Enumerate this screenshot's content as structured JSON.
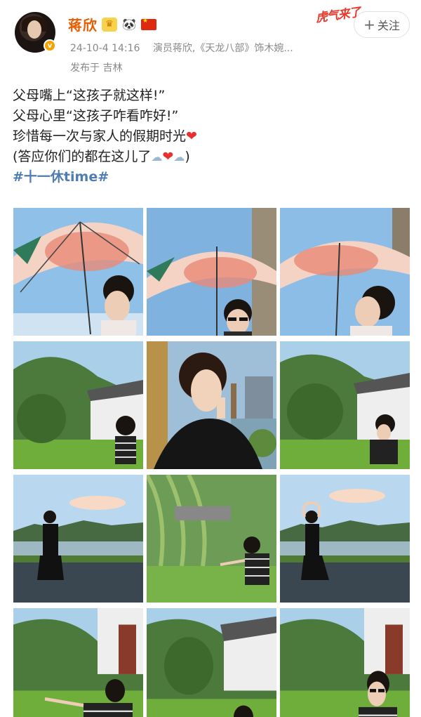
{
  "user": {
    "name": "蒋欣",
    "avatar_badge": "v",
    "badges": [
      "crown-icon",
      "panda-icon",
      "china-flag-icon"
    ]
  },
  "post_meta": {
    "date": "24-10-4 14:16",
    "source": "演员蒋欣,《天龙八部》饰木婉...",
    "location": "发布于 吉林"
  },
  "sticker": {
    "text": "虎气来了"
  },
  "follow_button": {
    "plus": "+",
    "label": "关注"
  },
  "content": {
    "line1": "父母嘴上“这孩子就这样!”",
    "line2": "父母心里“这孩子咋看咋好!”",
    "line3": "珍惜每一次与家人的假期时光",
    "line4_open": "(答应你们的都在这儿了",
    "line4_close": ")",
    "hashtag": "#十一休time#",
    "heart_glyph": "❤",
    "cloud_glyph": "☁"
  },
  "photos": [
    {
      "scene": "umbrella-closeup"
    },
    {
      "scene": "umbrella-sunglasses"
    },
    {
      "scene": "umbrella-profile"
    },
    {
      "scene": "garden-bench"
    },
    {
      "scene": "portrait-lake-pagoda"
    },
    {
      "scene": "garden-bench"
    },
    {
      "scene": "wall-sitting"
    },
    {
      "scene": "willow-garden"
    },
    {
      "scene": "wall-heart-pose"
    },
    {
      "scene": "garden-wave"
    },
    {
      "scene": "garden-crouch"
    },
    {
      "scene": "garden-sunglasses"
    }
  ],
  "colors": {
    "name": "#e85c00",
    "hashtag": "#4e7cb3",
    "meta": "#888888",
    "heart": "#e8312f"
  }
}
